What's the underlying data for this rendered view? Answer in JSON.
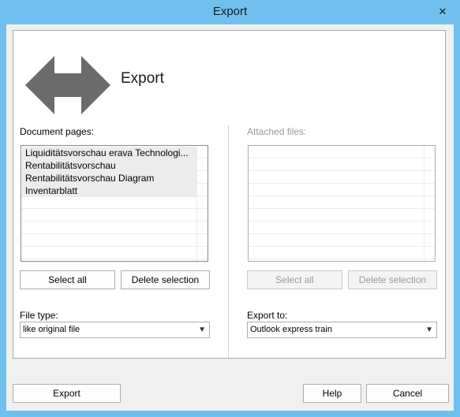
{
  "window": {
    "title": "Export",
    "close_glyph": "✕"
  },
  "header": {
    "title": "Export",
    "icon": "double-arrow-left-right-icon"
  },
  "left": {
    "label": "Document pages:",
    "items": [
      "Liquiditätsvorschau erava Technologi...",
      "Rentabilitätsvorschau",
      "Rentabilitätsvorschau Diagram",
      "Inventarblatt"
    ],
    "select_all": "Select all",
    "delete_selection": "Delete selection",
    "file_type_label": "File type:",
    "file_type_value": "like original file"
  },
  "right": {
    "label": "Attached files:",
    "select_all": "Select all",
    "delete_selection": "Delete selection",
    "export_to_label": "Export to:",
    "export_to_value": "Outlook express train"
  },
  "footer": {
    "export": "Export",
    "help": "Help",
    "cancel": "Cancel"
  },
  "colors": {
    "frame": "#6fc0ee",
    "client": "#f0f0f0",
    "icon": "#6b6b6b"
  }
}
